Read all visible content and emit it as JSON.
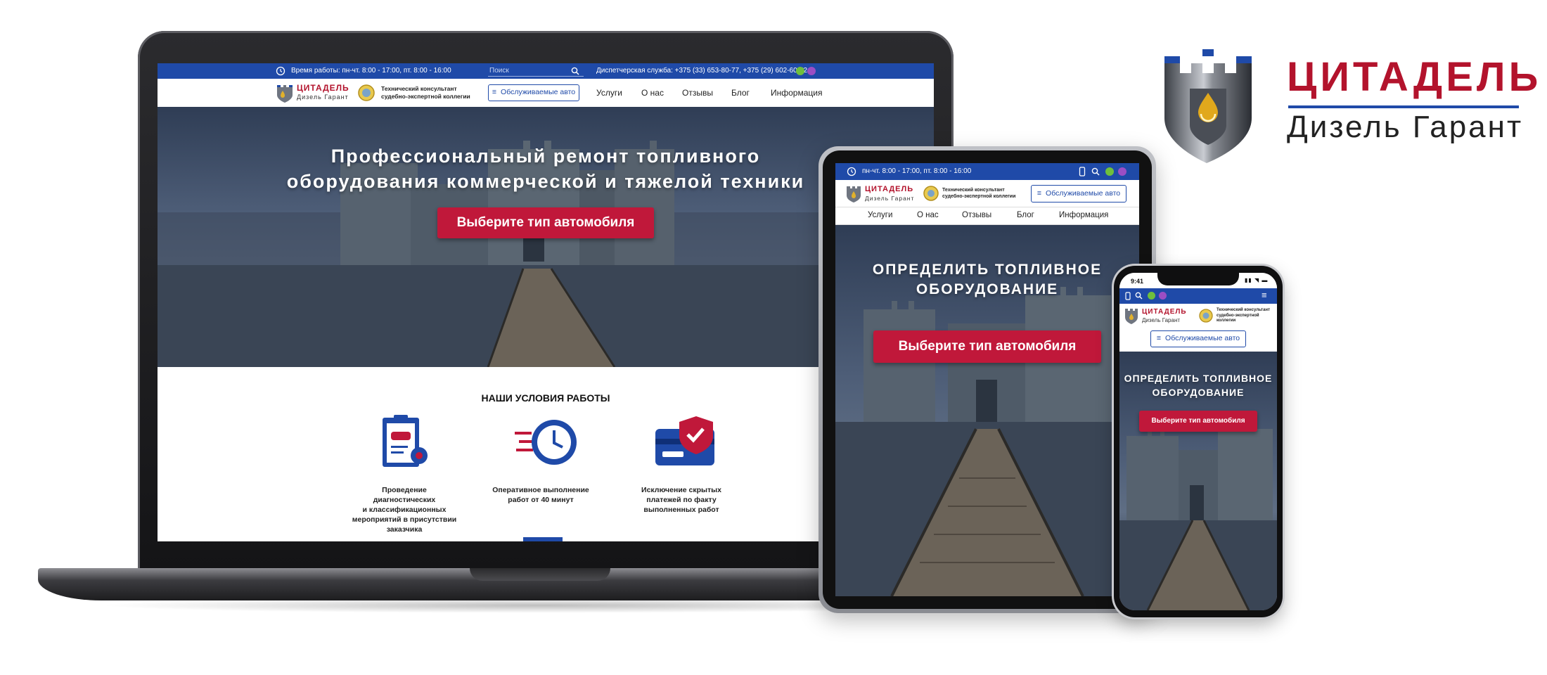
{
  "brand": {
    "title": "ЦИТАДЕЛЬ",
    "subtitle": "Дизель Гарант",
    "colors": {
      "primary_red": "#b3132c",
      "primary_blue": "#1f4aa8",
      "button_red": "#c0183a"
    }
  },
  "desktop": {
    "topbar": {
      "hours": "Время работы: пн-чт. 8:00 - 17:00, пт. 8:00 - 16:00",
      "search_placeholder": "Поиск",
      "dispatch": "Диспетчерская служба: +375 (33) 653-80-77, +375 (29) 602-60-72"
    },
    "header": {
      "logo_title": "ЦИТАДЕЛЬ",
      "logo_sub": "Дизель Гарант",
      "consultant_line1": "Технический консультант",
      "consultant_line2": "судебно-экспертной коллегии",
      "serviced_button": "Обслуживаемые авто",
      "nav": [
        "Услуги",
        "О нас",
        "Отзывы",
        "Блог",
        "Информация"
      ]
    },
    "hero": {
      "title_line1": "Профессиональный ремонт топливного",
      "title_line2": "оборудования коммерческой и тяжелой техники",
      "cta": "Выберите тип автомобиля"
    },
    "conditions": {
      "heading": "НАШИ УСЛОВИЯ РАБОТЫ",
      "items": [
        {
          "icon": "clipboard-car-icon",
          "line1": "Проведение диагностических",
          "line2": "и классификационных",
          "line3": "мероприятий в присутствии",
          "line4": "заказчика"
        },
        {
          "icon": "fast-clock-icon",
          "line1": "Оперативное выполнение",
          "line2": "работ от 40 минут",
          "line3": "",
          "line4": ""
        },
        {
          "icon": "card-shield-icon",
          "line1": "Исключение скрытых",
          "line2": "платежей по факту",
          "line3": "выполненных работ",
          "line4": ""
        }
      ]
    }
  },
  "tablet": {
    "topbar_hours": "пн-чт. 8:00 - 17:00, пт. 8:00 - 16:00",
    "logo_title": "ЦИТАДЕЛЬ",
    "logo_sub": "Дизель Гарант",
    "consultant_line1": "Технический консультант",
    "consultant_line2": "судебно-экспертной коллегии",
    "serviced_button": "Обслуживаемые авто",
    "nav": [
      "Услуги",
      "О нас",
      "Отзывы",
      "Блог",
      "Информация"
    ],
    "hero_line1": "ОПРЕДЕЛИТЬ ТОПЛИВНОЕ",
    "hero_line2": "ОБОРУДОВАНИЕ",
    "cta": "Выберите тип автомобиля"
  },
  "phone": {
    "time": "9:41",
    "logo_title": "ЦИТАДЕЛЬ",
    "logo_sub": "Дизель Гарант",
    "consultant_line1": "Технический консультант",
    "consultant_line2": "судебно-экспертной",
    "consultant_line3": "коллегии",
    "serviced_button": "Обслуживаемые авто",
    "hero_line1": "ОПРЕДЕЛИТЬ ТОПЛИВНОЕ",
    "hero_line2": "ОБОРУДОВАНИЕ",
    "cta": "Выберите тип автомобиля"
  }
}
